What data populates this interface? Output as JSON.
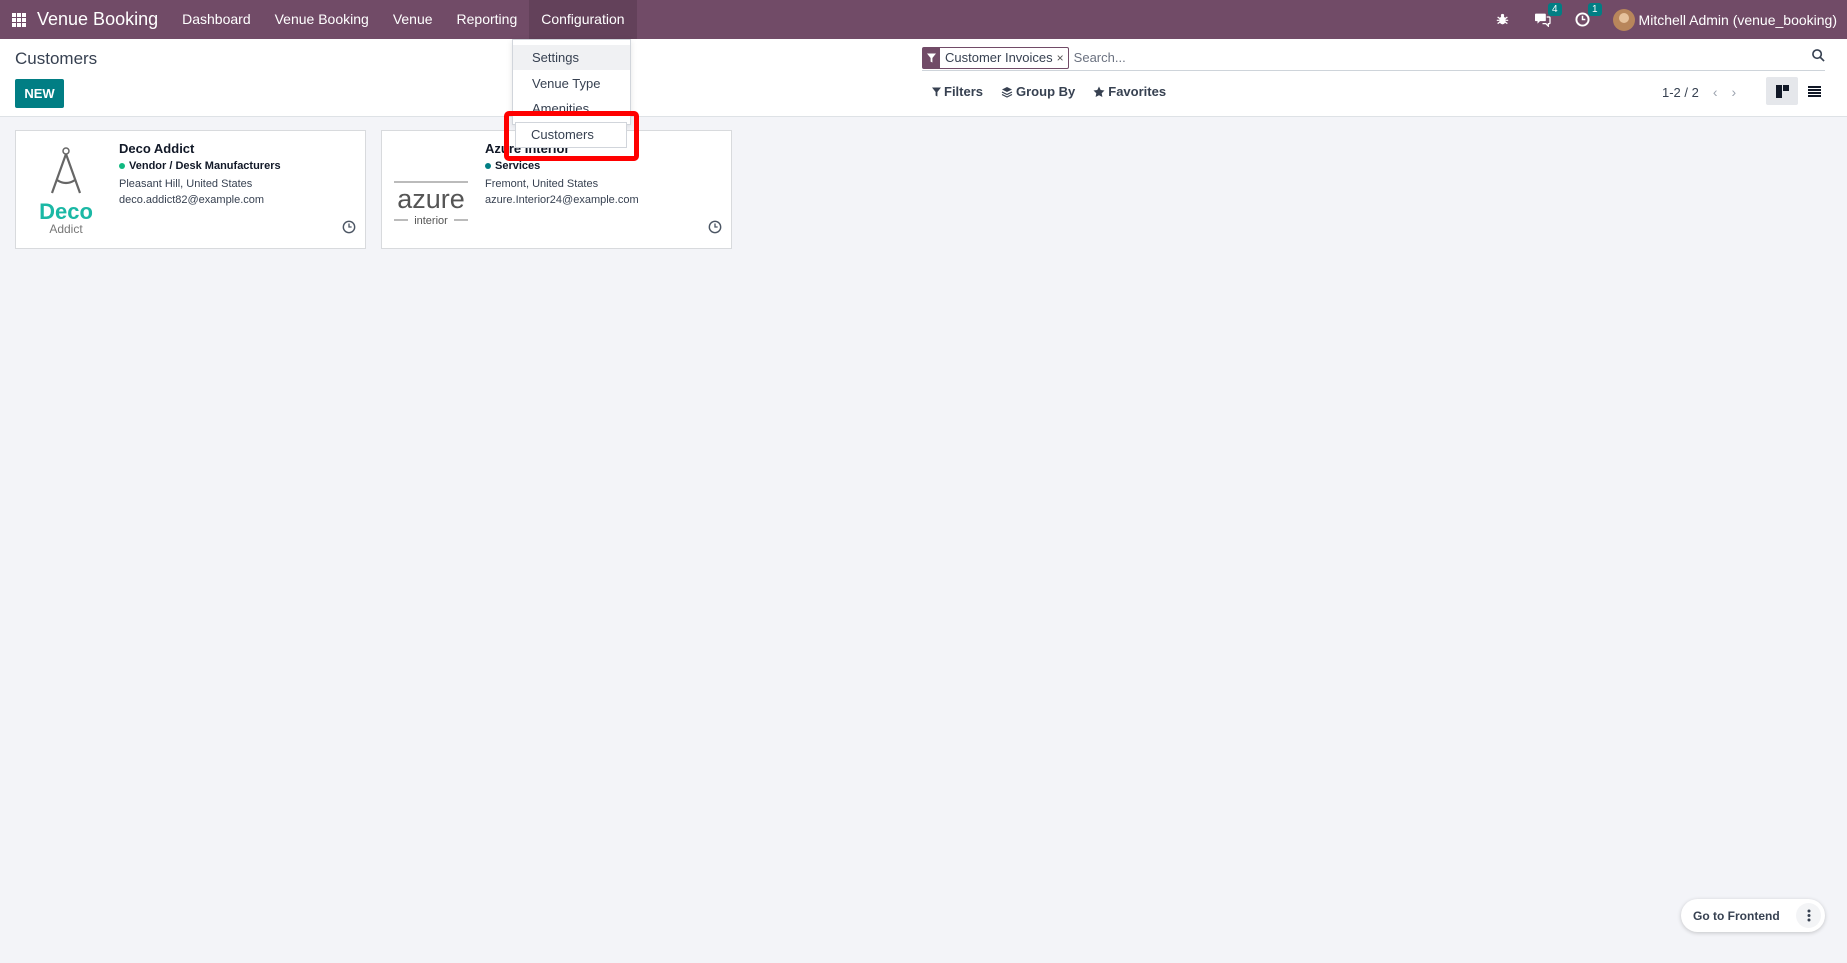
{
  "navbar": {
    "brand": "Venue Booking",
    "menu": [
      "Dashboard",
      "Venue Booking",
      "Venue",
      "Reporting",
      "Configuration"
    ],
    "messages_count": "4",
    "activities_count": "1",
    "user": "Mitchell Admin (venue_booking)"
  },
  "page": {
    "title": "Customers",
    "new_label": "NEW"
  },
  "search": {
    "facet": "Customer Invoices",
    "placeholder": "Search...",
    "filters_label": "Filters",
    "groupby_label": "Group By",
    "favorites_label": "Favorites"
  },
  "pager": {
    "value": "1-2 / 2"
  },
  "dropdown": {
    "items": [
      "Settings",
      "Venue Type",
      "Amenities",
      "Customers"
    ]
  },
  "cards": [
    {
      "name": "Deco Addict",
      "tag": "Vendor / Desk Manufacturers",
      "tag_color": "#10b981",
      "address": "Pleasant Hill, United States",
      "email": "deco.addict82@example.com",
      "logo_main": "Deco",
      "logo_sub": "Addict"
    },
    {
      "name": "Azure Interior",
      "tag": "Services",
      "tag_color": "#017e84",
      "address": "Fremont, United States",
      "email": "azure.Interior24@example.com",
      "logo_main": "azure",
      "logo_sub": "interior"
    }
  ],
  "footer": {
    "frontend_label": "Go to Frontend"
  }
}
